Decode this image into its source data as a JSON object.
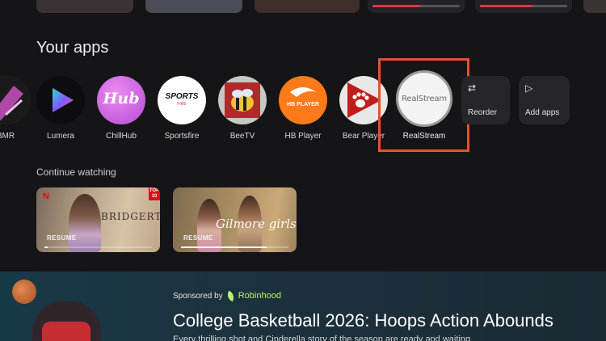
{
  "section_title": "Your apps",
  "apps": [
    {
      "label": "BMR",
      "icon": "app-logo-icon"
    },
    {
      "label": "Lumera",
      "icon": "lumera-logo-icon"
    },
    {
      "label": "ChillHub",
      "icon": "chillhub-logo-icon",
      "logo_text": "Hub"
    },
    {
      "label": "Sportsfire",
      "icon": "sportsfire-logo-icon",
      "logo_text": "SPORTS",
      "logo_sub": "FIRE"
    },
    {
      "label": "BeeTV",
      "icon": "bee-logo-icon"
    },
    {
      "label": "HB Player",
      "icon": "hb-player-logo-icon",
      "logo_text": "HB PLAYER"
    },
    {
      "label": "Bear Player",
      "icon": "paw-logo-icon"
    }
  ],
  "selected_app": {
    "label": "RealStream",
    "logo_text": "RealStream"
  },
  "tools": [
    {
      "label": "Reorder",
      "icon": "reorder-icon"
    },
    {
      "label": "Add apps",
      "icon": "play-store-icon"
    }
  ],
  "continue_watching": {
    "title": "Continue watching",
    "items": [
      {
        "show": "BRIDGERTON",
        "resume_label": "RESUME",
        "progress": 0.03,
        "provider": "N",
        "badge": "TOP 10"
      },
      {
        "show": "Gilmore girls",
        "resume_label": "RESUME",
        "progress": 0.8
      }
    ]
  },
  "sponsored": {
    "prefix": "Sponsored by",
    "brand": "Robinhood",
    "headline": "College Basketball 2026: Hoops Action Abounds",
    "subline": "Every thrilling shot and Cinderella story of the season are ready and waiting"
  },
  "colors": {
    "background": "#151517",
    "highlight_border": "#e2532a",
    "progress_red": "#e0393e",
    "brand_green": "#b7f06a"
  },
  "top_row_progress": [
    0.55,
    0.6
  ]
}
